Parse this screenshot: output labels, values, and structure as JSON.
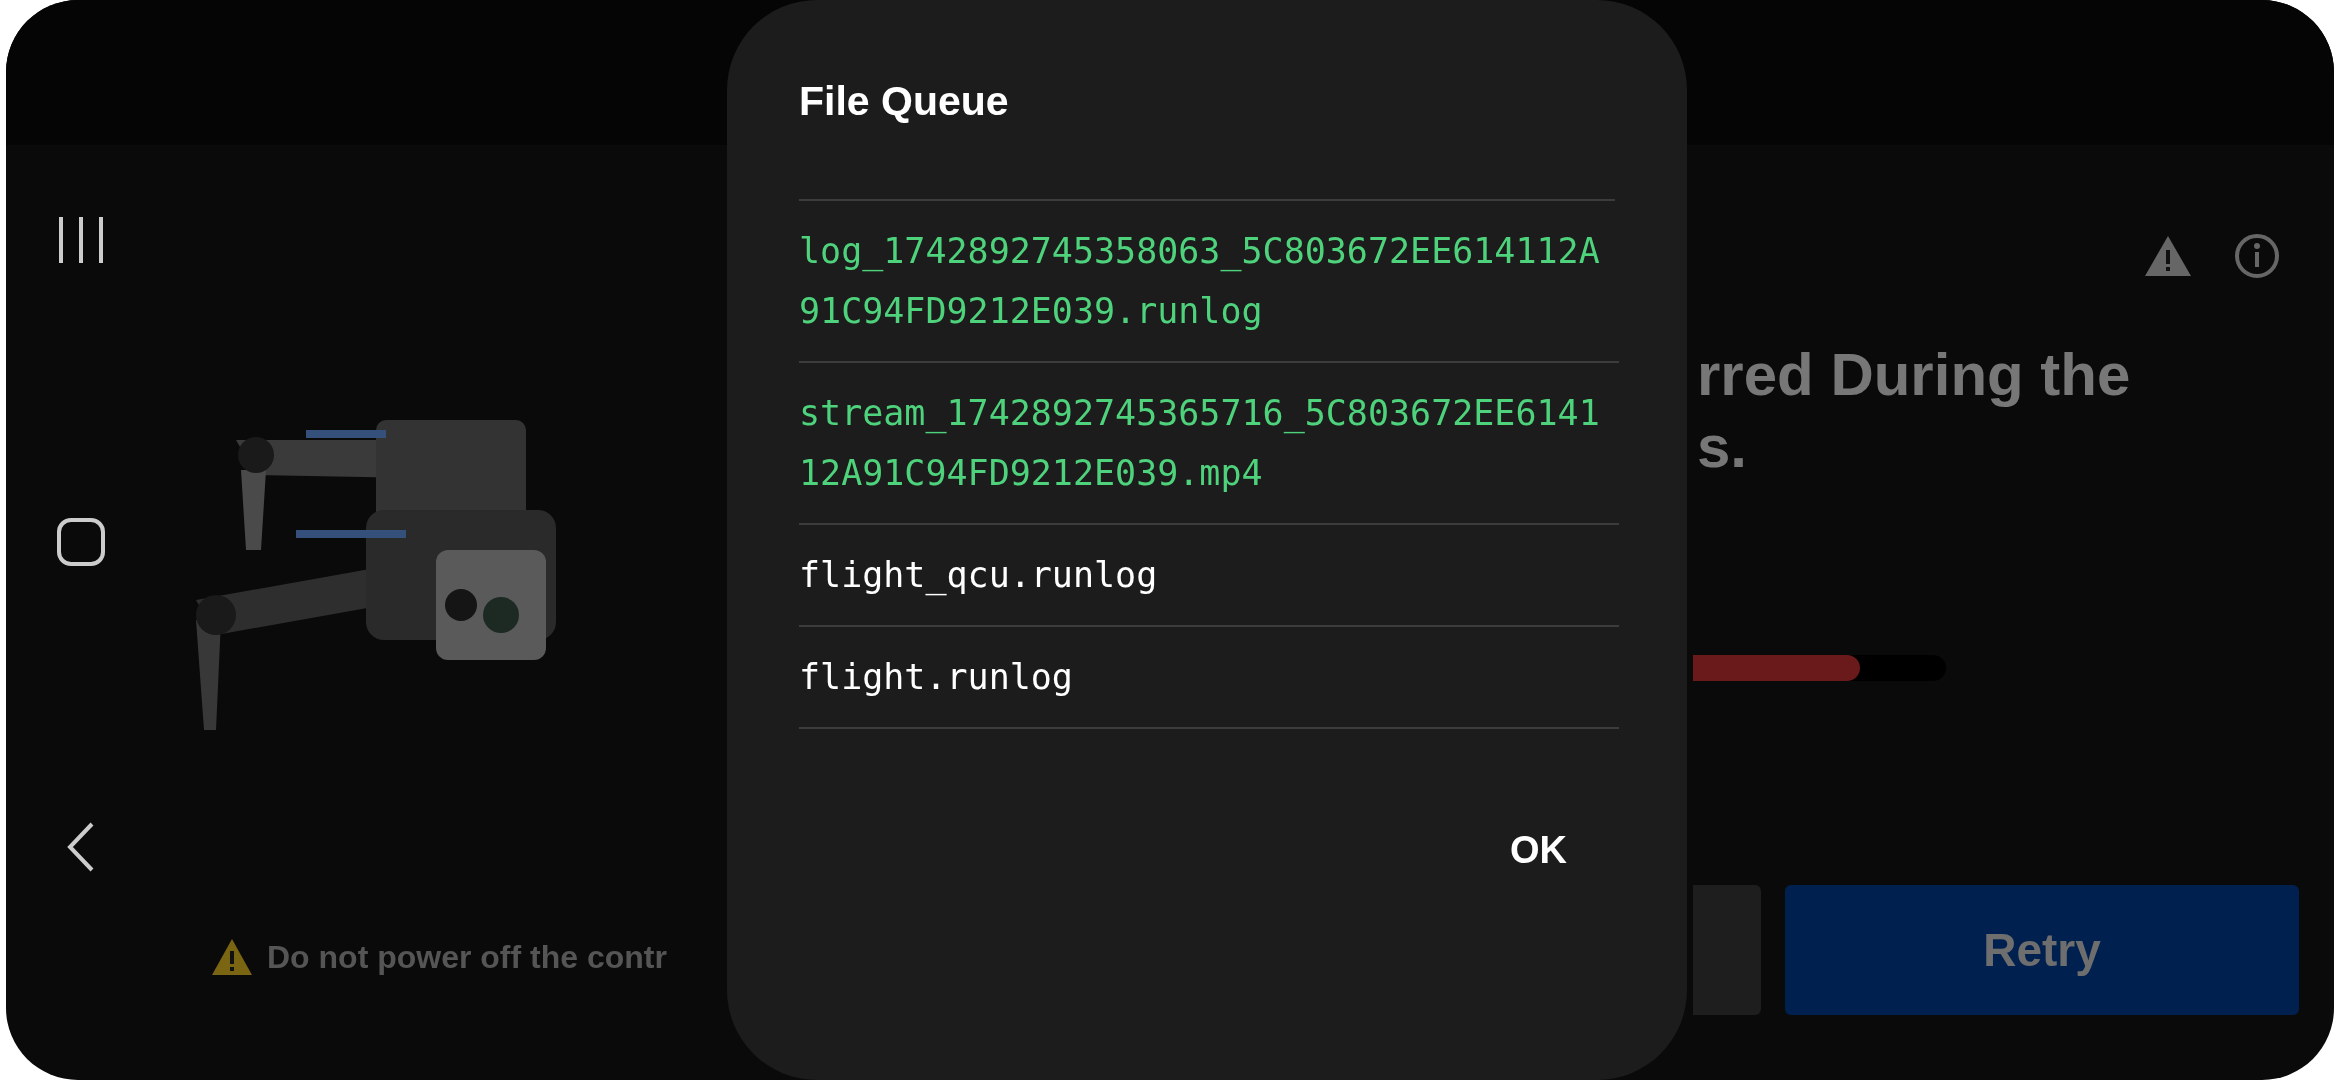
{
  "background": {
    "warning_note": "Do not power off the contr",
    "heading_lines": [
      "rred During the",
      "s."
    ],
    "progress": {
      "level": 0.66
    },
    "retry_button": "Retry"
  },
  "dialog": {
    "title": "File Queue",
    "files": [
      {
        "name": "log_1742892745358063_5C803672EE614112A91C94FD9212E039.runlog",
        "color": "#4ed27c"
      },
      {
        "name": "stream_1742892745365716_5C803672EE614112A91C94FD9212E039.mp4",
        "color": "#4ed27c"
      },
      {
        "name": "flight_qcu.runlog",
        "color": "#ffffff"
      },
      {
        "name": "flight.runlog",
        "color": "#ffffff"
      }
    ],
    "ok_button": "OK"
  }
}
